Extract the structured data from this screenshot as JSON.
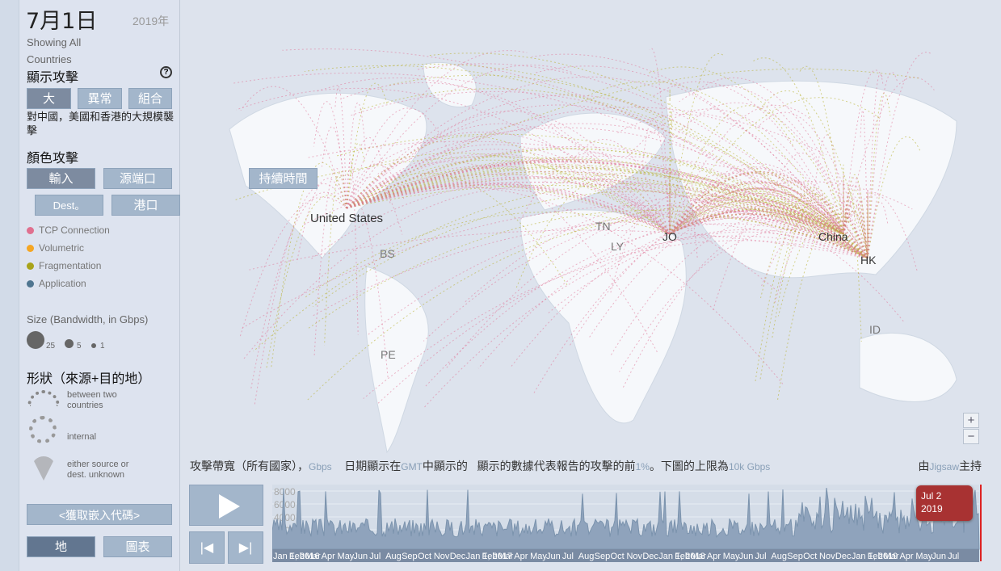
{
  "panel": {
    "date": "7月1日",
    "year": "2019年",
    "showing": "Showing All Countries",
    "show_attacks": "顯示攻擊",
    "help_icon": "?",
    "attack_buttons": [
      "大",
      "異常",
      "組合"
    ],
    "description": "對中國，美國和香港的大規模襲擊",
    "color_attacks": "顏色攻擊",
    "color_buttons": [
      "輸入",
      "源端口",
      "Dest。",
      "港口",
      "持續時間"
    ],
    "legend": [
      {
        "label": "TCP Connection",
        "color": "#e0708f"
      },
      {
        "label": "Volumetric",
        "color": "#f5a623"
      },
      {
        "label": "Fragmentation",
        "color": "#a8a31a"
      },
      {
        "label": "Application",
        "color": "#4f7590"
      }
    ],
    "size_title": "Size (Bandwidth, in Gbps)",
    "sizes": [
      "25",
      "5",
      "1"
    ],
    "shape_title": "形狀（來源+目的地）",
    "shapes": [
      "between two countries",
      "internal",
      "either source or dest. unknown"
    ],
    "embed": "<獲取嵌入代碼>",
    "view_buttons": [
      "地",
      "圖表"
    ]
  },
  "map": {
    "labels": [
      {
        "t": "United States"
      },
      {
        "t": "BS"
      },
      {
        "t": "PE"
      },
      {
        "t": "TN"
      },
      {
        "t": "LY"
      },
      {
        "t": "JO"
      },
      {
        "t": "China"
      },
      {
        "t": "HK"
      },
      {
        "t": "ID"
      }
    ],
    "zoom_in": "+",
    "zoom_out": "−"
  },
  "bottom": {
    "caption_1": "攻擊帶寬（所有國家）",
    "caption_sep": "，",
    "unit": "Gbps",
    "caption_2": "日期顯示在",
    "gmt": "GMT",
    "caption_3": "中顯示的",
    "caption_4": "顯示的數據代表報告的攻擊的前",
    "pct": "1%",
    "caption_5": "。下圖的上限為",
    "limit": "10k Gbps",
    "host_1": "由",
    "host_brand": "Jigsaw",
    "host_2": "主持",
    "y_ticks": [
      "8000",
      "6000",
      "4000",
      "2000"
    ],
    "months": [
      "Jan 1, 2016",
      "Feb",
      "Mar",
      "Apr",
      "May",
      "Jun",
      "Jul",
      "Aug",
      "Sep",
      "Oct",
      "Nov",
      "Dec",
      "Jan 1, 2017",
      "Feb",
      "Mar",
      "Apr",
      "May",
      "Jun",
      "Jul",
      "Aug",
      "Sep",
      "Oct",
      "Nov",
      "Dec",
      "Jan 1, 2018",
      "Feb",
      "Mar",
      "Apr",
      "May",
      "Jun",
      "Jul",
      "Aug",
      "Sep",
      "Oct",
      "Nov",
      "Dec",
      "Jan 1, 2019",
      "Feb",
      "Mar",
      "Apr",
      "May",
      "Jun",
      "Jul"
    ],
    "tooltip_date": "Jul 2",
    "tooltip_year": "2019"
  }
}
